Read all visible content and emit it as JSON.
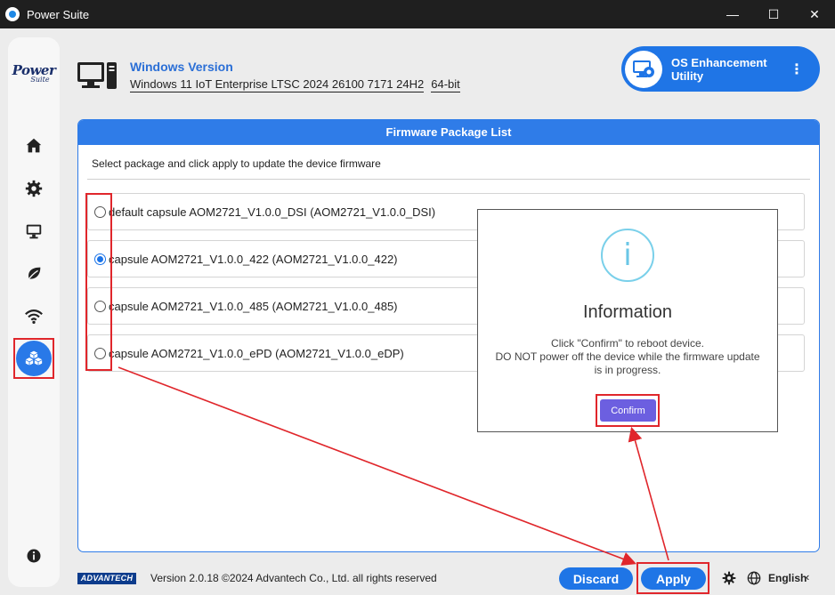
{
  "window": {
    "title": "Power Suite",
    "minimize": "—",
    "maximize": "☐",
    "close": "✕"
  },
  "sidebar": {
    "logo_main": "Power",
    "logo_sub": "Suite",
    "items": [
      {
        "icon": "home-icon"
      },
      {
        "icon": "gear-icon"
      },
      {
        "icon": "monitor-icon"
      },
      {
        "icon": "leaf-icon"
      },
      {
        "icon": "wifi-icon"
      },
      {
        "icon": "packages-icon",
        "active": true
      },
      {
        "icon": "info-icon"
      }
    ]
  },
  "header": {
    "windows_label": "Windows Version",
    "windows_value": "Windows 11 IoT Enterprise LTSC 2024 26100 7171 24H2",
    "arch": "64-bit",
    "os_button_line1": "OS Enhancement",
    "os_button_line2": "Utility",
    "os_button_menu": "⋮"
  },
  "firmware": {
    "title": "Firmware Package List",
    "description": "Select package and click apply to update the device firmware",
    "packages": [
      {
        "label": "default capsule AOM2721_V1.0.0_DSI (AOM2721_V1.0.0_DSI)",
        "selected": false
      },
      {
        "label": "capsule AOM2721_V1.0.0_422 (AOM2721_V1.0.0_422)",
        "selected": true
      },
      {
        "label": "capsule AOM2721_V1.0.0_485 (AOM2721_V1.0.0_485)",
        "selected": false
      },
      {
        "label": "capsule AOM2721_V1.0.0_ePD (AOM2721_V1.0.0_eDP)",
        "selected": false
      }
    ]
  },
  "dialog": {
    "icon_glyph": "i",
    "title": "Information",
    "line1": "Click \"Confirm\" to reboot device.",
    "line2": "DO NOT power off the device while the firmware update",
    "line3": "is in progress.",
    "confirm_label": "Confirm"
  },
  "footer": {
    "brand": "ADVANTECH",
    "version": "Version 2.0.18 ©2024 Advantech Co., Ltd. all rights reserved",
    "discard_label": "Discard",
    "apply_label": "Apply",
    "language": "English",
    "language_chevron": "‹"
  },
  "colors": {
    "accent": "#1f75e6",
    "confirm": "#6c5fe0",
    "annotation": "#e0262b",
    "info": "#7ad0ea"
  }
}
